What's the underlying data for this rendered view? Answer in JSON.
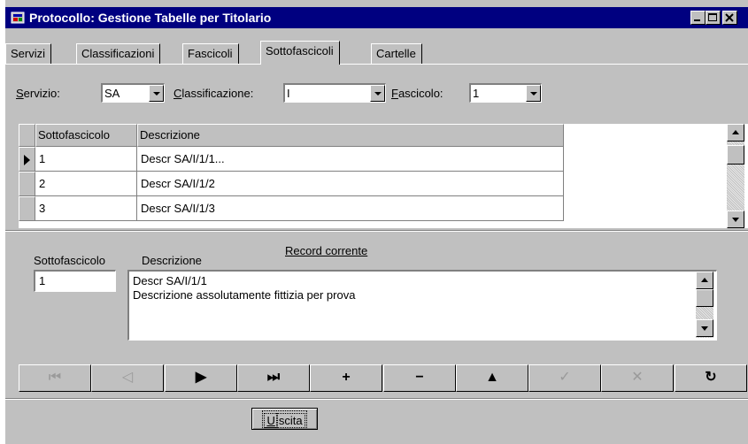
{
  "window": {
    "title": "Protocollo: Gestione Tabelle per Titolario",
    "icon": "app-icon",
    "controls": [
      "minimize-icon",
      "maximize-icon",
      "close-icon"
    ]
  },
  "tabs": [
    {
      "label": "Servizi",
      "active": false
    },
    {
      "label": "Classificazioni",
      "active": false
    },
    {
      "label": "Fascicoli",
      "active": false
    },
    {
      "label": "Sottofascicoli",
      "active": true
    },
    {
      "label": "Cartelle",
      "active": false
    }
  ],
  "filters": {
    "servizio_label": "Servizio:",
    "servizio_value": "SA",
    "classificazione_label": "Classificazione:",
    "classificazione_value": "I",
    "fascicolo_label": "Fascicolo:",
    "fascicolo_value": "1"
  },
  "grid": {
    "columns": [
      "Sottofascicolo",
      "Descrizione"
    ],
    "rows": [
      {
        "sottofascicolo": "1",
        "descrizione": "Descr SA/I/1/1...",
        "current": true
      },
      {
        "sottofascicolo": "2",
        "descrizione": "Descr SA/I/1/2",
        "current": false
      },
      {
        "sottofascicolo": "3",
        "descrizione": "Descr SA/I/1/3",
        "current": false
      }
    ]
  },
  "record": {
    "heading": "Record corrente",
    "sottofascicolo_label": "Sottofascicolo",
    "descrizione_label": "Descrizione",
    "sottofascicolo_value": "1",
    "descrizione_lines": [
      "Descr SA/I/1/1",
      "Descrizione assolutamente fittizia per  prova"
    ]
  },
  "navigator": [
    {
      "name": "first-record-icon",
      "glyph": "⏮",
      "enabled": false
    },
    {
      "name": "prior-record-icon",
      "glyph": "◁",
      "enabled": false
    },
    {
      "name": "next-record-icon",
      "glyph": "▶",
      "enabled": true
    },
    {
      "name": "last-record-icon",
      "glyph": "⏭",
      "enabled": true
    },
    {
      "name": "insert-record-icon",
      "glyph": "+",
      "enabled": true
    },
    {
      "name": "delete-record-icon",
      "glyph": "−",
      "enabled": true
    },
    {
      "name": "edit-record-icon",
      "glyph": "▲",
      "enabled": true
    },
    {
      "name": "post-edit-icon",
      "glyph": "✓",
      "enabled": false
    },
    {
      "name": "cancel-edit-icon",
      "glyph": "✕",
      "enabled": false
    },
    {
      "name": "refresh-data-icon",
      "glyph": "↻",
      "enabled": true
    }
  ],
  "exit_button": {
    "label": "Uscita"
  },
  "colors": {
    "titlebar": "#000080",
    "face": "#c0c0c0",
    "window": "#ffffff"
  }
}
